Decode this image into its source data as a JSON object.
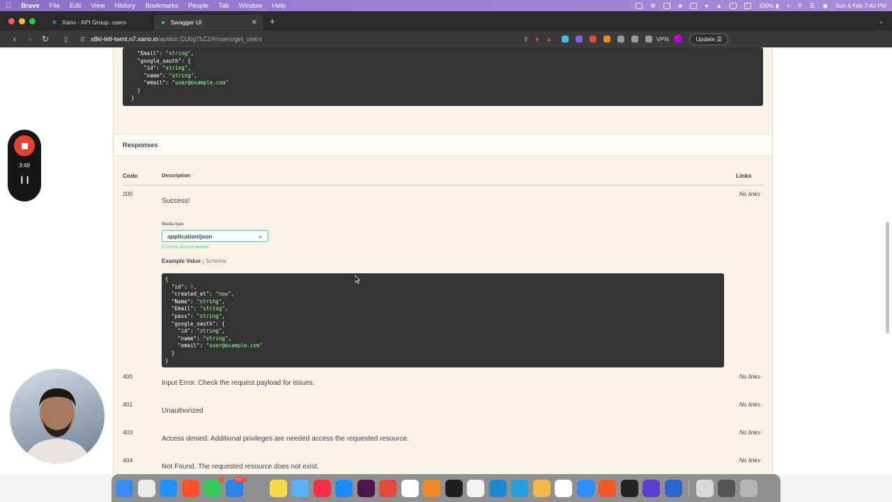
{
  "menubar": {
    "app": "Brave",
    "items": [
      "File",
      "Edit",
      "View",
      "History",
      "Bookmarks",
      "People",
      "Tab",
      "Window",
      "Help"
    ],
    "battery": "100%",
    "datetime": "Sun 4 Feb 7:40 PM"
  },
  "tabs": [
    {
      "title": "Xano - API Group: users",
      "icon": "xano-icon",
      "active": false
    },
    {
      "title": "Swagger UI",
      "icon": "swagger-icon",
      "active": true
    }
  ],
  "toolbar": {
    "url_host": "x8ki-letl-twmt.n7.xano.io",
    "url_path": "/apidoc:CUbg7bZ2/#/users/get_users",
    "vpn_label": "VPN",
    "update_label": "Update"
  },
  "top_code": {
    "lines": [
      {
        "k": "\"Email\"",
        "v": "\"string\"",
        "suffix": ","
      },
      {
        "k": "\"google_oauth\"",
        "v": "{",
        "suffix": ""
      },
      {
        "k": "  \"id\"",
        "v": "\"string\"",
        "suffix": ","
      },
      {
        "k": "  \"name\"",
        "v": "\"string\"",
        "suffix": ","
      },
      {
        "k": "  \"email\"",
        "v": "\"user@example.com\"",
        "suffix": ""
      },
      {
        "k": "}",
        "v": "",
        "suffix": ""
      }
    ],
    "close": "}"
  },
  "responses": {
    "heading": "Responses",
    "col_code": "Code",
    "col_description": "Description",
    "col_links": "Links",
    "media_type_label": "Media type",
    "media_type_value": "application/json",
    "controls_accept": "Controls Accept header.",
    "tab_example": "Example Value",
    "tab_schema": "Schema",
    "example_code": {
      "open": "{",
      "lines": [
        {
          "k": "\"id\"",
          "v": "0",
          "type": "num",
          "suffix": ","
        },
        {
          "k": "\"created_at\"",
          "v": "\"now\"",
          "type": "str",
          "suffix": ","
        },
        {
          "k": "\"Name\"",
          "v": "\"string\"",
          "type": "str",
          "suffix": ","
        },
        {
          "k": "\"Email\"",
          "v": "\"string\"",
          "type": "str",
          "suffix": ","
        },
        {
          "k": "\"pass\"",
          "v": "\"string\"",
          "type": "str",
          "suffix": ","
        },
        {
          "k": "\"google_oauth\"",
          "v": "{",
          "type": "plain",
          "suffix": ""
        },
        {
          "k": "  \"id\"",
          "v": "\"string\"",
          "type": "str",
          "suffix": ","
        },
        {
          "k": "  \"name\"",
          "v": "\"string\"",
          "type": "str",
          "suffix": ","
        },
        {
          "k": "  \"email\"",
          "v": "\"user@example.com\"",
          "type": "str",
          "suffix": ""
        }
      ],
      "inner_close": "}",
      "close": "}"
    },
    "rows": [
      {
        "code": "200",
        "description": "Success!",
        "links": "No links"
      },
      {
        "code": "400",
        "description": "Input Error. Check the request payload for issues.",
        "links": "No links"
      },
      {
        "code": "401",
        "description": "Unauthorized",
        "links": "No links"
      },
      {
        "code": "403",
        "description": "Access denied. Additional privileges are needed access the requested resource.",
        "links": "No links"
      },
      {
        "code": "404",
        "description": "Not Found. The requested resource does not exist.",
        "links": "No links"
      }
    ]
  },
  "recorder": {
    "time": "3:49"
  },
  "dock": {
    "apps": [
      {
        "name": "finder-icon",
        "color": "#3b8cf2"
      },
      {
        "name": "launchpad-icon",
        "color": "#e9e9e9"
      },
      {
        "name": "safari-icon",
        "color": "#1e90ff"
      },
      {
        "name": "brave-icon",
        "color": "#fb542b"
      },
      {
        "name": "messages-icon",
        "color": "#34c759",
        "badge": "1"
      },
      {
        "name": "mail-icon",
        "color": "#2f7fe8",
        "badge": "6,677"
      },
      {
        "name": "settings-icon",
        "color": "#8e8e93"
      },
      {
        "name": "notes-icon",
        "color": "#ffd84a"
      },
      {
        "name": "freeform-icon",
        "color": "#5ab0ff"
      },
      {
        "name": "music-icon",
        "color": "#fa2d48"
      },
      {
        "name": "app-store-icon",
        "color": "#1a8cff"
      },
      {
        "name": "slack-icon",
        "color": "#4a154b"
      },
      {
        "name": "screen-tool-icon",
        "color": "#e24a3b"
      },
      {
        "name": "notion-icon",
        "color": "#ffffff"
      },
      {
        "name": "vlc-icon",
        "color": "#f08a24"
      },
      {
        "name": "figma-icon",
        "color": "#1e1e1e"
      },
      {
        "name": "reminders-icon",
        "color": "#f2f2f2"
      },
      {
        "name": "vscode-icon",
        "color": "#1f8ad2"
      },
      {
        "name": "refresh-app-icon",
        "color": "#27a0e0"
      },
      {
        "name": "sheets-icon",
        "color": "#f2b84b"
      },
      {
        "name": "calendar-icon",
        "color": "#ffffff"
      },
      {
        "name": "zoom-icon",
        "color": "#2d8cff"
      },
      {
        "name": "pen-app-icon",
        "color": "#f05a28"
      },
      {
        "name": "terminal-icon",
        "color": "#222222"
      },
      {
        "name": "shield-app-icon",
        "color": "#5b3fd1"
      },
      {
        "name": "word-icon",
        "color": "#2b65c8"
      }
    ],
    "tail": [
      {
        "name": "downloads-icon",
        "color": "#d9d9d9"
      },
      {
        "name": "window-thumbnail-icon",
        "color": "#555555"
      },
      {
        "name": "trash-icon",
        "color": "#b5b5b5"
      }
    ]
  }
}
